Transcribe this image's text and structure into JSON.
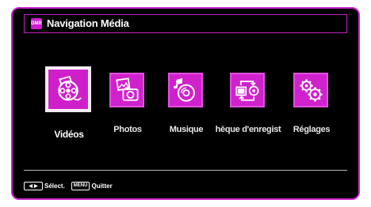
{
  "window": {
    "title": "Navigation Média",
    "title_icon_text": "DMR",
    "title_icon": "media-navigation-icon"
  },
  "menu": {
    "items": [
      {
        "label": "Vidéos",
        "icon": "film-reel-icon",
        "selected": true
      },
      {
        "label": "Photos",
        "icon": "camera-photo-icon",
        "selected": false
      },
      {
        "label": "Musique",
        "icon": "music-disc-icon",
        "selected": false
      },
      {
        "label": "hèque d'enregist",
        "icon": "recording-library-icon",
        "selected": false
      },
      {
        "label": "Réglages",
        "icon": "settings-gears-icon",
        "selected": false
      }
    ]
  },
  "footer": {
    "select_key_icon": "left-right-arrows-icon",
    "select_label": "Sélect.",
    "menu_key": "MENU",
    "quit_label": "Quitter"
  },
  "colors": {
    "accent": "#cc22cc",
    "background": "#000000",
    "text": "#ffffff"
  }
}
